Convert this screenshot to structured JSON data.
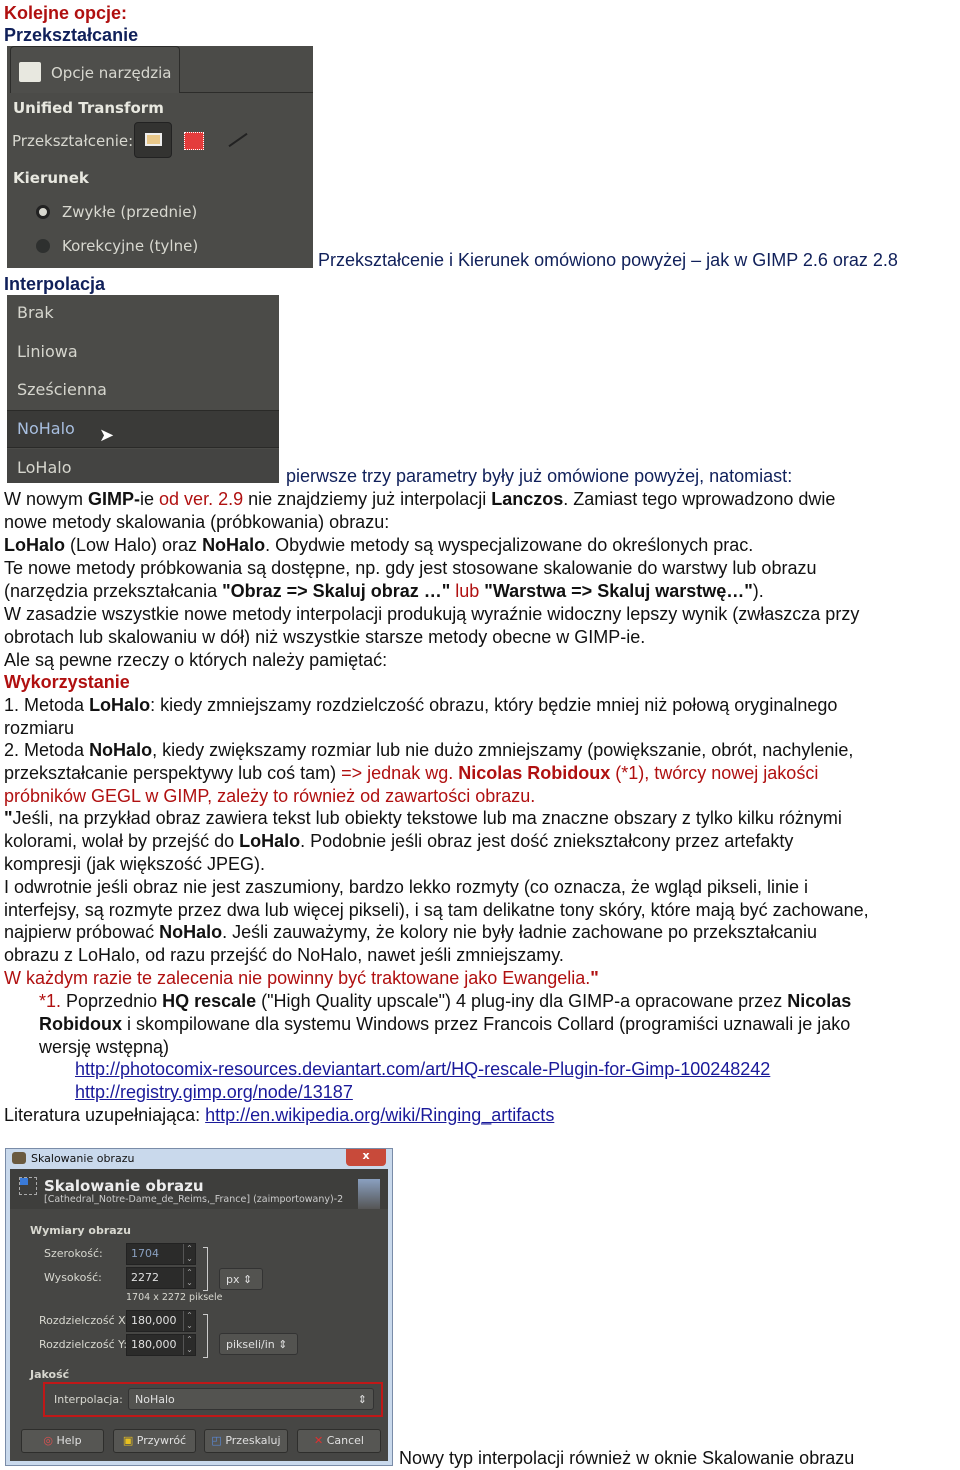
{
  "heading1": "Kolejne opcje:",
  "heading2": "Przekształcanie",
  "tool_options": {
    "tab_label": "Opcje narzędzia",
    "tool_name": "Unified Transform",
    "transform_label": "Przekształcenie:",
    "direction_label": "Kierunek",
    "radio_normal": "Zwykłe (przednie)",
    "radio_corrective": "Korekcyjne (tylne)",
    "selected_direction": "Zwykłe (przednie)"
  },
  "caption1": "Przekształcenie i Kierunek omówiono powyżej – jak w GIMP 2.6 oraz 2.8",
  "heading3": "Interpolacja",
  "interp_menu": {
    "items": [
      "Brak",
      "Liniowa",
      "Sześcienna",
      "NoHalo",
      "LoHalo"
    ],
    "hovered": "NoHalo"
  },
  "caption2": "pierwsze trzy parametry były już omówione powyżej, natomiast:",
  "body": [
    [
      [
        "n",
        "W nowym "
      ],
      [
        "b",
        "GIMP-"
      ],
      [
        "n",
        "ie "
      ],
      [
        "r",
        "od ver. 2.9"
      ],
      [
        "n",
        " nie znajdziemy już interpolacji "
      ],
      [
        "b",
        "Lanczos"
      ],
      [
        "n",
        ". Zamiast tego wprowadzono dwie"
      ]
    ],
    [
      [
        "n",
        "nowe metody skalowania (próbkowania) obrazu:"
      ]
    ],
    [
      [
        "b",
        "LoHalo"
      ],
      [
        "n",
        " (Low Halo) oraz "
      ],
      [
        "b",
        "NoHalo"
      ],
      [
        "n",
        ". Obydwie metody są wyspecjalizowane do określonych prac."
      ]
    ],
    [
      [
        "n",
        "Te nowe metody próbkowania są dostępne, np. gdy jest stosowane skalowanie do warstwy lub obrazu"
      ]
    ],
    [
      [
        "n",
        "(narzędzia przekształcania "
      ],
      [
        "b",
        "\"Obraz => Skaluj obraz …\""
      ],
      [
        "r",
        " lub "
      ],
      [
        "b",
        "\"Warstwa => Skaluj warstwę…\""
      ],
      [
        "n",
        ")."
      ]
    ],
    [
      [
        "n",
        "W zasadzie wszystkie nowe metody interpolacji produkują wyraźnie widoczny lepszy wynik (zwłaszcza przy"
      ]
    ],
    [
      [
        "n",
        "obrotach lub skalowaniu w dół) niż wszystkie starsze metody obecne w GIMP-ie."
      ]
    ],
    [
      [
        "n",
        "Ale są pewne rzeczy o których należy pamiętać:"
      ]
    ],
    [
      [
        "rb",
        "Wykorzystanie"
      ]
    ],
    [
      [
        "n",
        "1. Metoda "
      ],
      [
        "b",
        "LoHalo"
      ],
      [
        "n",
        ": kiedy zmniejszamy rozdzielczość obrazu, który będzie mniej niż połową oryginalnego"
      ]
    ],
    [
      [
        "n",
        "rozmiaru"
      ]
    ],
    [
      [
        "n",
        "2. Metoda "
      ],
      [
        "b",
        "NoHalo"
      ],
      [
        "n",
        ", kiedy zwiększamy rozmiar lub nie dużo zmniejszamy (powiększanie, obrót, nachylenie,"
      ]
    ],
    [
      [
        "n",
        "przekształcanie perspektywy lub coś tam) "
      ],
      [
        "r",
        "=> jednak wg. "
      ],
      [
        "rb",
        "Nicolas Robidoux"
      ],
      [
        "r",
        " (*1), twórcy nowej jakości"
      ]
    ],
    [
      [
        "r",
        "próbników GEGL w GIMP, zależy to również od zawartości obrazu."
      ]
    ],
    [
      [
        "b",
        "\""
      ],
      [
        "n",
        "Jeśli, na przykład obraz zawiera tekst lub obiekty tekstowe lub ma znaczne obszary z tylko kilku różnymi"
      ]
    ],
    [
      [
        "n",
        "kolorami, wolał by przejść do "
      ],
      [
        "b",
        "LoHalo"
      ],
      [
        "n",
        ".  Podobnie jeśli obraz jest dość zniekształcony przez artefakty"
      ]
    ],
    [
      [
        "n",
        "kompresji (jak większość JPEG)."
      ]
    ],
    [
      [
        "n",
        "I odwrotnie jeśli obraz nie jest zaszumiony, bardzo lekko rozmyty (co oznacza, że wgląd pikseli, linie i"
      ]
    ],
    [
      [
        "n",
        "interfejsy, są rozmyte przez dwa lub więcej pikseli), i są tam delikatne tony skóry, które mają być zachowane,"
      ]
    ],
    [
      [
        "n",
        "najpierw próbować "
      ],
      [
        "b",
        "NoHalo"
      ],
      [
        "n",
        ". Jeśli zauważymy, że kolory nie były ładnie zachowane po przekształcaniu"
      ]
    ],
    [
      [
        "n",
        "obrazu z LoHalo, od razu przejść do NoHalo, nawet jeśli zmniejszamy."
      ]
    ],
    [
      [
        "r",
        "W każdym razie te zalecenia nie powinny być traktowane jako Ewangelia."
      ],
      [
        "rb",
        "\""
      ]
    ],
    [
      [
        "r",
        "*1."
      ],
      [
        "n",
        " Poprzednio "
      ],
      [
        "b",
        "HQ rescale"
      ],
      [
        "n",
        " (\"High Quality upscale\") 4 plug-iny dla GIMP-a opracowane przez "
      ],
      [
        "b",
        "Nicolas"
      ]
    ],
    [
      [
        "b",
        "Robidoux"
      ],
      [
        "n",
        " i skompilowane dla systemu Windows przez Francois Collard (programiści uznawali je jako"
      ]
    ],
    [
      [
        "n",
        "wersję wstępną)"
      ]
    ],
    [
      [
        "l",
        "http://photocomix-resources.deviantart.com/art/HQ-rescale-Plugin-for-Gimp-100248242"
      ]
    ],
    [
      [
        "l",
        "http://registry.gimp.org/node/13187"
      ]
    ],
    [
      [
        "n",
        "Literatura uzupełniająca: "
      ],
      [
        "l",
        "http://en.wikipedia.org/wiki/Ringing_artifacts"
      ]
    ]
  ],
  "dialog": {
    "window_title": "Skalowanie obrazu",
    "close_label": "x",
    "header_title": "Skalowanie obrazu",
    "header_subtitle": "[Cathedral_Notre-Dame_de_Reims,_France] (zaimportowany)-2",
    "section_dimensions": "Wymiary obrazu",
    "width_label": "Szerokość:",
    "width_value": "1704",
    "height_label": "Wysokość:",
    "height_value": "2272",
    "size_info": "1704 x 2272 piksele",
    "unit": "px",
    "res_x_label": "Rozdzielczość X:",
    "res_x_value": "180,000",
    "res_y_label": "Rozdzielczość Y:",
    "res_y_value": "180,000",
    "res_unit": "pikseli/in",
    "section_quality": "Jakość",
    "interp_label": "Interpolacja:",
    "interp_value": "NoHalo",
    "buttons": {
      "help": "Help",
      "reset": "Przywróć",
      "scale": "Przeskaluj",
      "cancel": "Cancel"
    }
  },
  "caption3": "Nowy typ interpolacji również w oknie Skalowanie obrazu",
  "colors": {
    "accent_red": "#b01010",
    "heading_navy": "#10205a",
    "link": "#1a1a9a",
    "gimp_bg": "#4b4b48",
    "highlight_box": "#c01818"
  }
}
